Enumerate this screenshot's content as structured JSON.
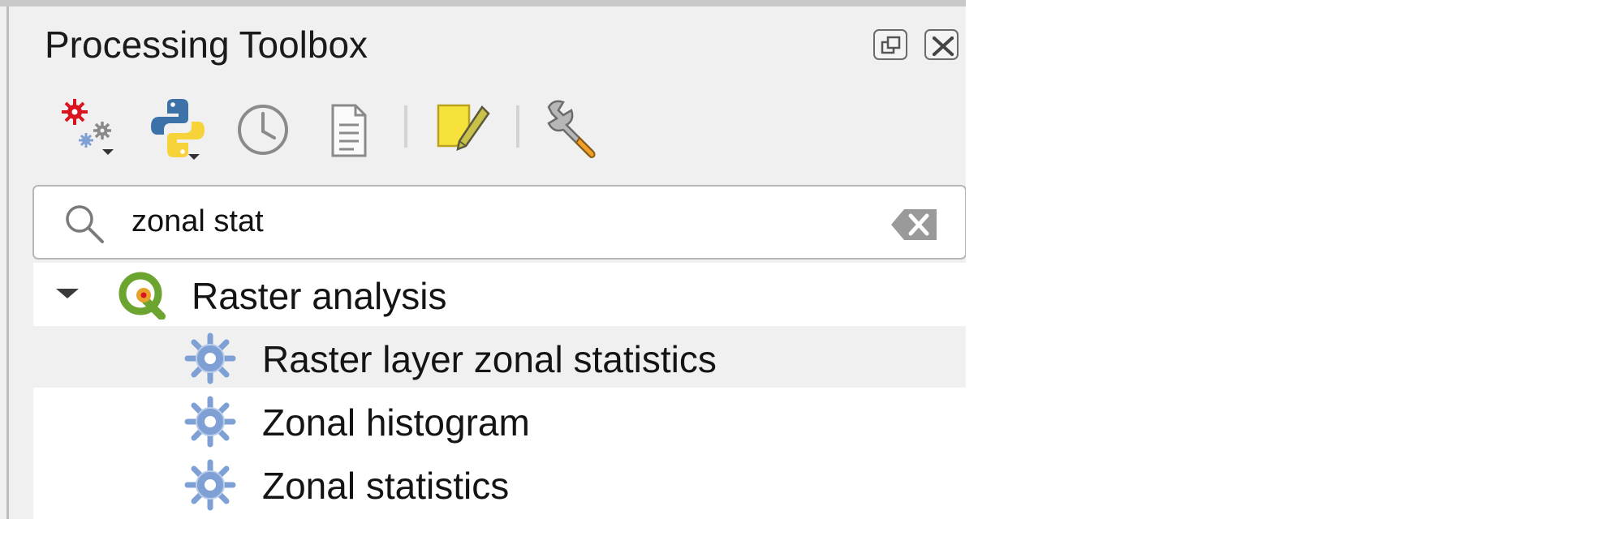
{
  "panel": {
    "title": "Processing Toolbox",
    "window_buttons": [
      {
        "name": "float-dock-icon"
      },
      {
        "name": "close-dock-icon"
      }
    ]
  },
  "toolbar": [
    {
      "name": "models-icon",
      "has_dropdown": true
    },
    {
      "name": "python-scripts-icon",
      "has_dropdown": true
    },
    {
      "name": "history-icon"
    },
    {
      "name": "results-viewer-icon"
    },
    {
      "name": "edit-features-in-place-icon"
    },
    {
      "name": "options-icon"
    }
  ],
  "search": {
    "value": "zonal stat",
    "clear_icon": "clear-text-icon"
  },
  "tree": {
    "group": {
      "label": "Raster analysis",
      "expanded": true,
      "icon": "qgis-logo-icon"
    },
    "items": [
      {
        "label": "Raster layer zonal statistics",
        "icon": "algorithm-gear-icon",
        "highlighted": true
      },
      {
        "label": "Zonal histogram",
        "icon": "algorithm-gear-icon",
        "highlighted": false
      },
      {
        "label": "Zonal statistics",
        "icon": "algorithm-gear-icon",
        "highlighted": false
      }
    ]
  },
  "colors": {
    "panel_bg": "#f0f0f0",
    "gear_blue": "#7ea0d4",
    "qgis_green": "#6ba42f",
    "qgis_orange": "#e8a22c",
    "edit_yellow": "#f7e23b",
    "settings_red": "#d9141f"
  }
}
